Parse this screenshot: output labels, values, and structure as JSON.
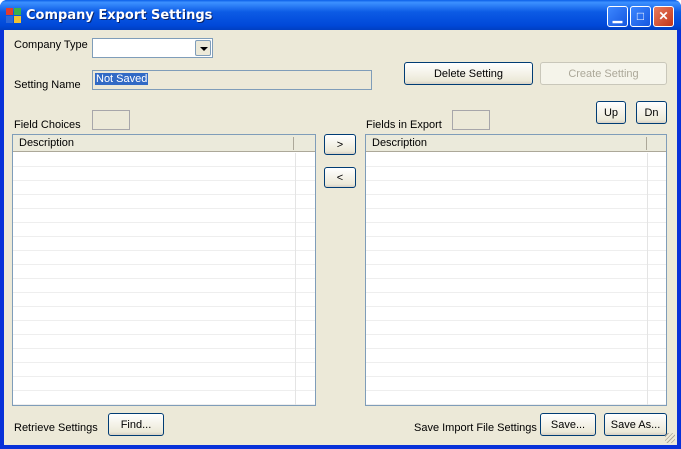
{
  "window": {
    "title": "Company Export Settings",
    "icon": "app-window-icon",
    "controls": [
      "minimize-icon",
      "maximize-icon",
      "close-icon"
    ]
  },
  "form": {
    "company_type_label": "Company Type",
    "company_type_value": "",
    "setting_name_label": "Setting Name",
    "setting_name_value": "Not Saved",
    "delete_setting_label": "Delete Setting",
    "create_setting_label": "Create Setting",
    "field_choices_label": "Field Choices",
    "fields_in_export_label": "Fields in Export",
    "up_label": "Up",
    "dn_label": "Dn",
    "move_right_label": ">",
    "move_left_label": "<",
    "field_choices_table": {
      "columns": [
        "Description"
      ],
      "rows": []
    },
    "fields_in_export_table": {
      "columns": [
        "Description"
      ],
      "rows": []
    },
    "retrieve_settings_label": "Retrieve Settings",
    "find_label": "Find...",
    "save_import_label": "Save Import File Settings",
    "save_label": "Save...",
    "save_as_label": "Save As..."
  },
  "colors": {
    "titlebar": "#0058e6",
    "client_bg": "#ece9d8",
    "selection": "#316ac5"
  }
}
